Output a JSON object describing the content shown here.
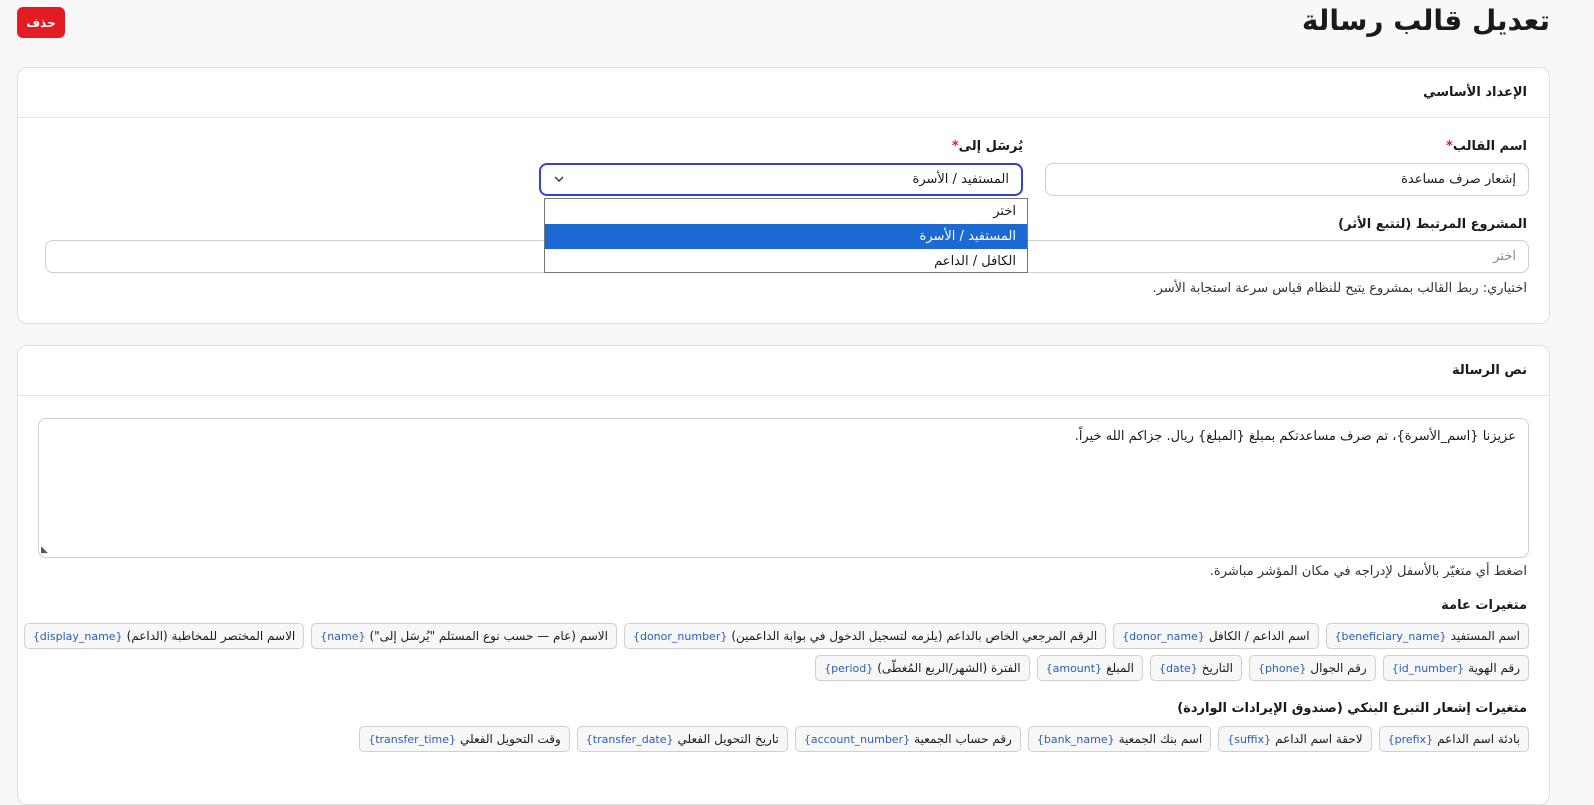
{
  "header": {
    "title": "تعديل قالب رسالة",
    "delete_label": "حذف"
  },
  "basic_settings": {
    "title": "الإعداد الأساسي",
    "template_name": {
      "label": "اسم القالب",
      "required_mark": "*",
      "value": "إشعار صرف مساعدة"
    },
    "send_to": {
      "label": "يُرسَل إلى",
      "required_mark": "*",
      "value": "المستفيد / الأسرة",
      "options": [
        "اختر",
        "المستفيد / الأسرة",
        "الكافل / الداعم"
      ]
    },
    "project": {
      "label": "المشروع المرتبط (لتتبع الأثر)",
      "placeholder": "اختر"
    },
    "project_hint": "اختياري: ربط القالب بمشروع يتيح للنظام قياس سرعة استجابة الأسر."
  },
  "message": {
    "title": "نص الرسالة",
    "body": "عزيزنا {اسم_الأسرة}، تم صرف مساعدتكم بمبلغ {المبلغ} ريال. جزاكم الله خيراً.",
    "hint": "اضغط أي متغيّر بالأسفل لإدراجه في مكان المؤشر مباشرة.",
    "general_title": "متغيرات عامة",
    "general_row1": [
      {
        "label": "اسم المستفيد",
        "code": "{beneficiary_name}"
      },
      {
        "label": "اسم الداعم / الكافل",
        "code": "{donor_name}"
      },
      {
        "label": "الرقم المرجعي الخاص بالداعم (يلزمه لتسجيل الدخول في بوابة الداعمين)",
        "code": "{donor_number}"
      },
      {
        "label": "الاسم (عام — حسب نوع المستلم \"يُرسَل إلى\")",
        "code": "{name}"
      },
      {
        "label": "الاسم المختصر للمخاطبة (الداعم)",
        "code": "{display_name}"
      }
    ],
    "general_row2": [
      {
        "label": "رقم الهوية",
        "code": "{id_number}"
      },
      {
        "label": "رقم الجوال",
        "code": "{phone}"
      },
      {
        "label": "التاريخ",
        "code": "{date}"
      },
      {
        "label": "المبلغ",
        "code": "{amount}"
      },
      {
        "label": "الفترة (الشهر/الربع المُغطّى)",
        "code": "{period}"
      }
    ],
    "bank_title": "متغيرات إشعار التبرع البنكي (صندوق الإيرادات الواردة)",
    "bank_row": [
      {
        "label": "بادئة اسم الداعم",
        "code": "{prefix}"
      },
      {
        "label": "لاحقة اسم الداعم",
        "code": "{suffix}"
      },
      {
        "label": "اسم بنك الجمعية",
        "code": "{bank_name}"
      },
      {
        "label": "رقم حساب الجمعية",
        "code": "{account_number}"
      },
      {
        "label": "تاريخ التحويل الفعلي",
        "code": "{transfer_date}"
      },
      {
        "label": "وقت التحويل الفعلي",
        "code": "{transfer_time}"
      }
    ]
  }
}
